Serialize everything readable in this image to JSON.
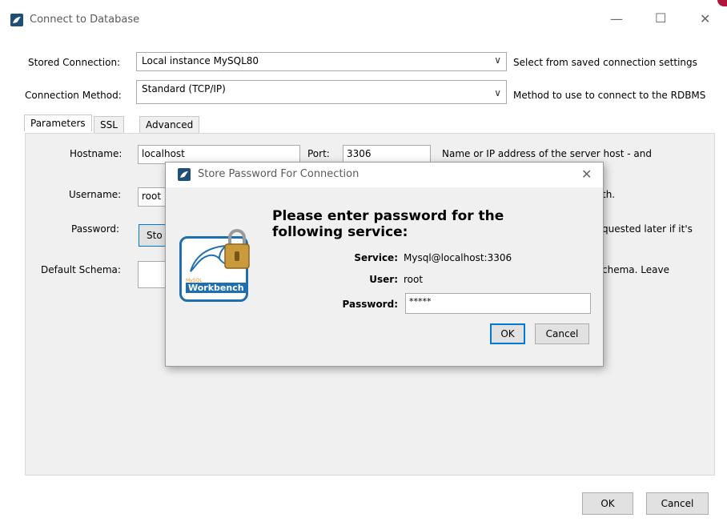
{
  "window": {
    "title": "Connect to Database",
    "controls": {
      "minimize": "—",
      "maximize": "☐",
      "close": "✕"
    }
  },
  "stored_connection": {
    "label": "Stored Connection:",
    "value": "Local instance MySQL80",
    "hint": "Select from saved connection settings"
  },
  "connection_method": {
    "label": "Connection Method:",
    "value": "Standard (TCP/IP)",
    "hint": "Method to use to connect to the RDBMS"
  },
  "tabs": [
    "Parameters",
    "SSL",
    "Advanced"
  ],
  "params": {
    "hostname_label": "Hostname:",
    "hostname_value": "localhost",
    "port_label": "Port:",
    "port_value": "3306",
    "hostname_hint": "Name or IP address of the server host - and",
    "username_label": "Username:",
    "username_value": "root",
    "username_hint": "th.",
    "password_label": "Password:",
    "store_button": "Sto",
    "password_hint": "quested later if it's",
    "schema_label": "Default Schema:",
    "schema_hint": "chema. Leave"
  },
  "footer": {
    "ok": "OK",
    "cancel": "Cancel"
  },
  "dialog": {
    "title": "Store Password For Connection",
    "close": "✕",
    "heading_line1": "Please enter password for the",
    "heading_line2": "following service:",
    "service_label": "Service:",
    "service_value": "Mysql@localhost:3306",
    "user_label": "User:",
    "user_value": "root",
    "password_label": "Password:",
    "password_value": "*****",
    "ok": "OK",
    "cancel": "Cancel",
    "logo_small": "MySQL",
    "logo_text": "Workbench"
  },
  "colors": {
    "window_bg": "#ffffff",
    "panel_bg": "#f0f0f0",
    "focus_blue": "#0078d7",
    "logo_blue": "#1f6fb0"
  }
}
